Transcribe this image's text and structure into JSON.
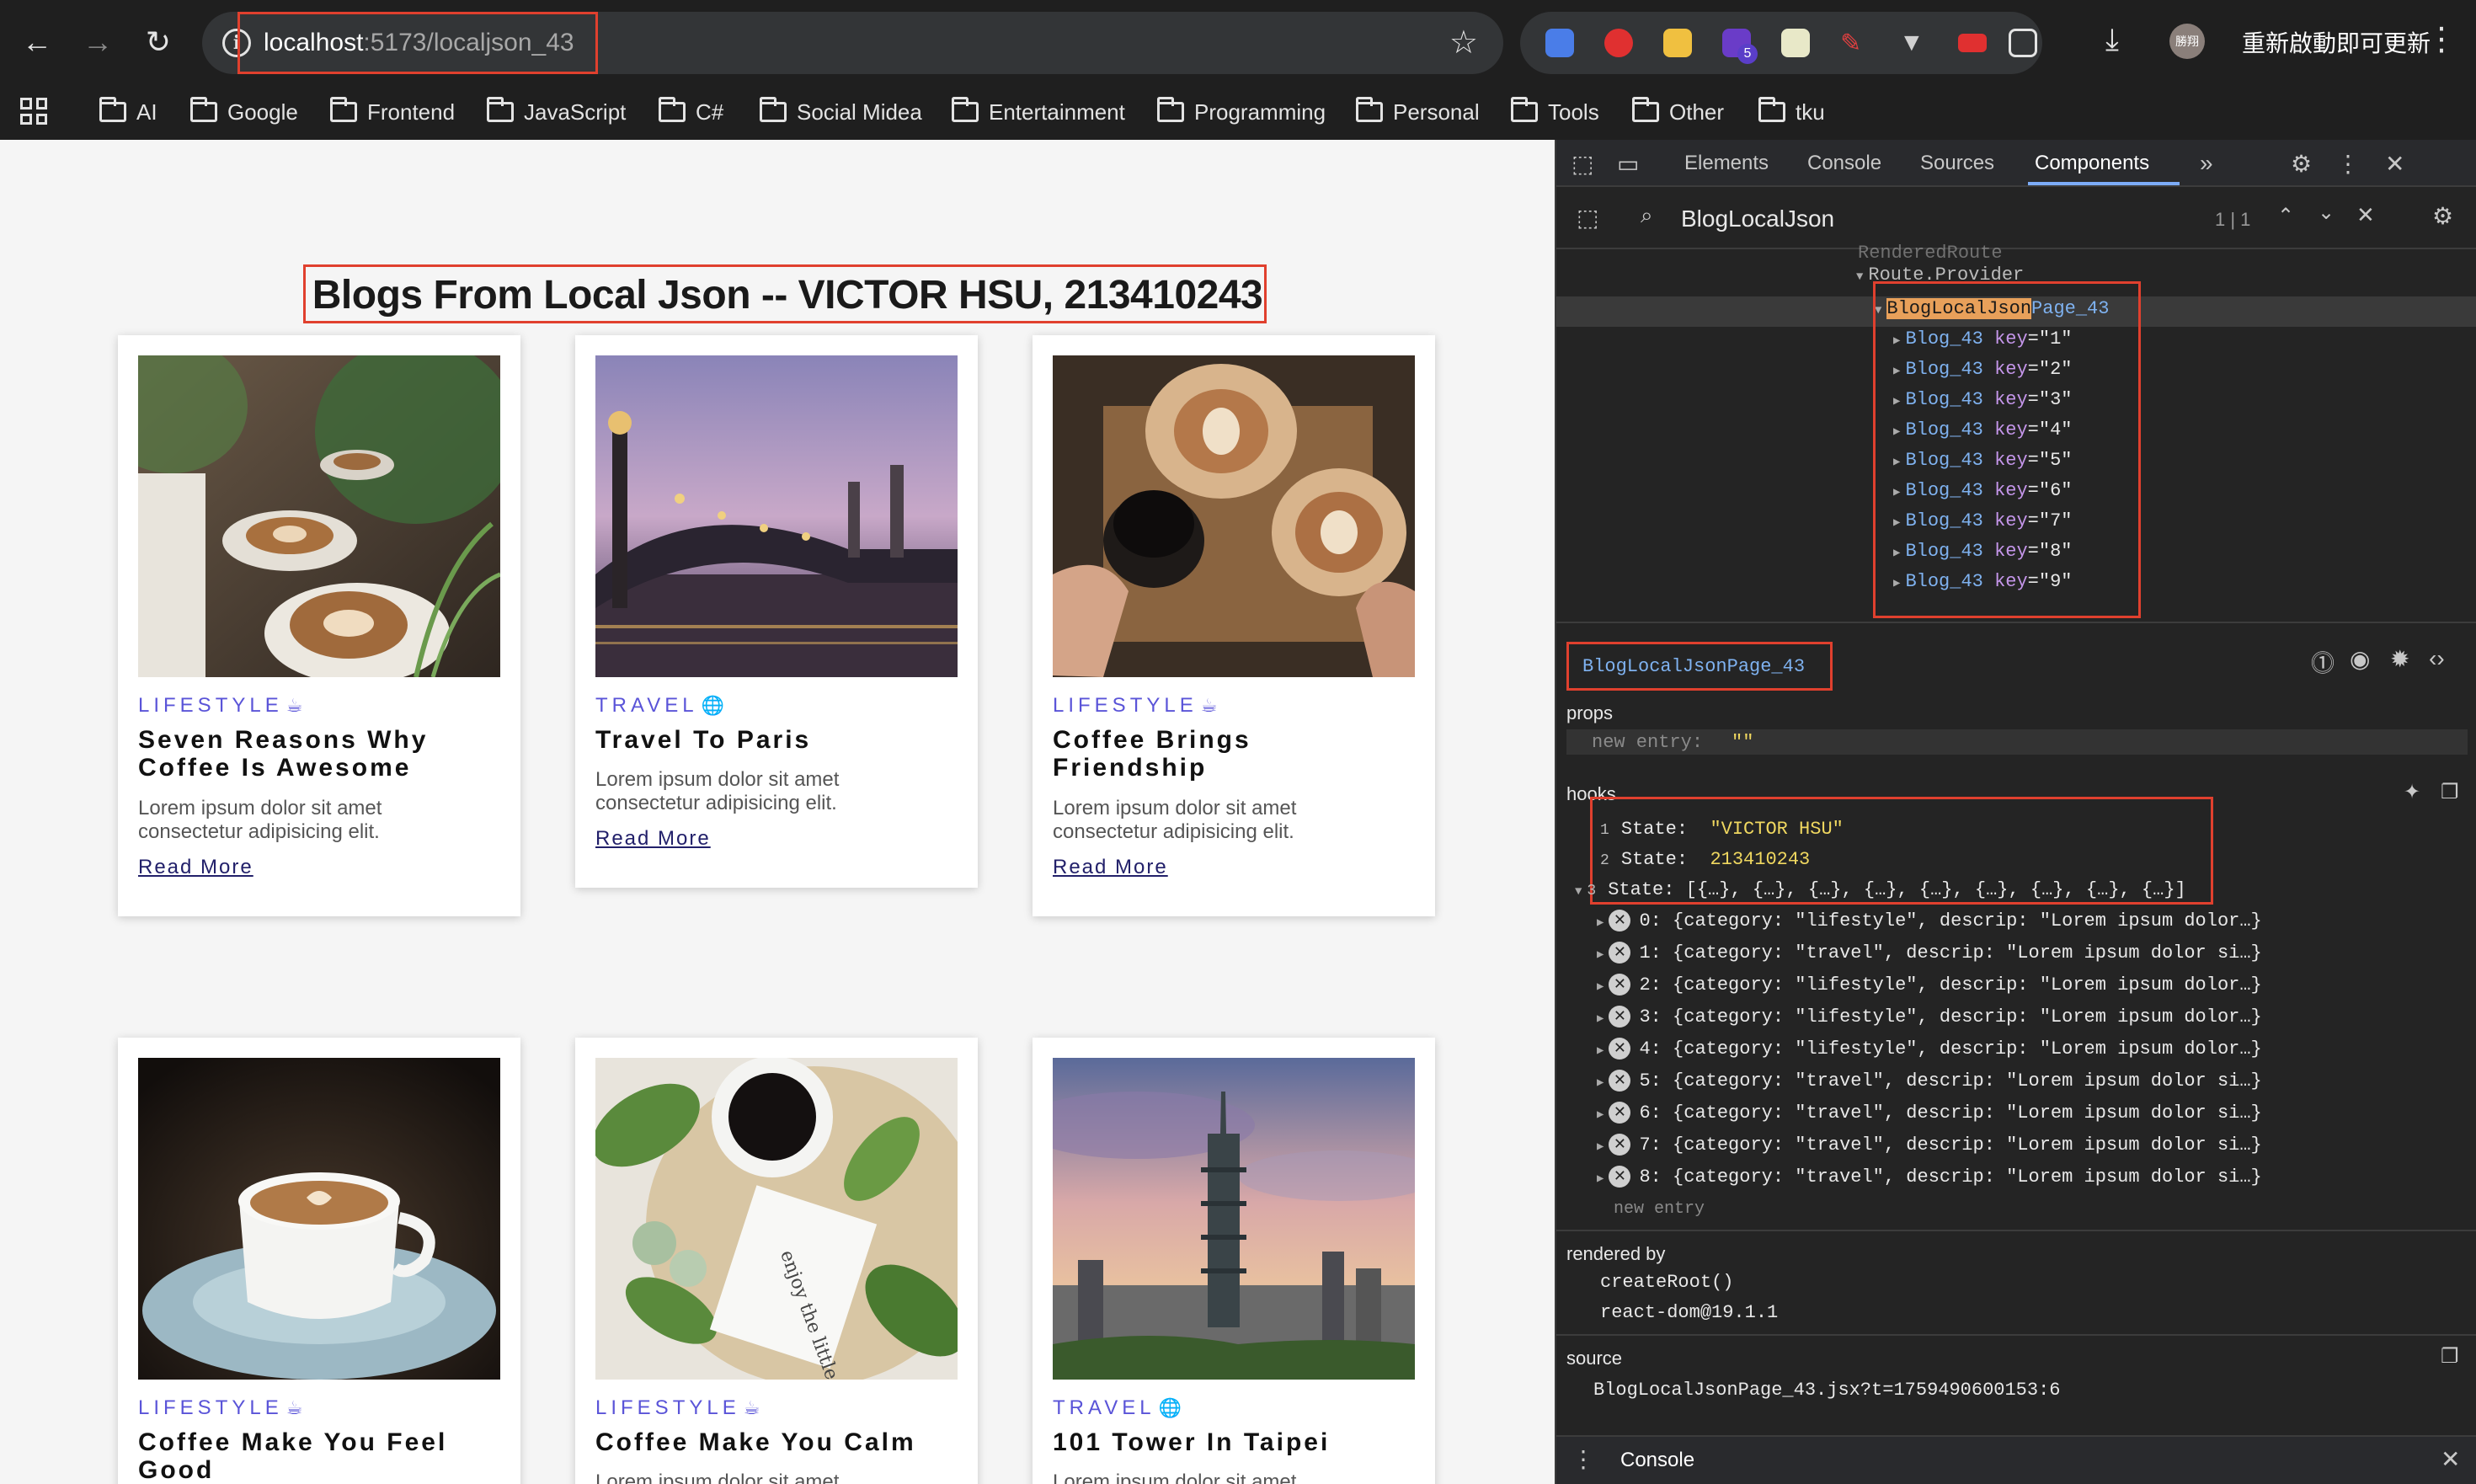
{
  "browser": {
    "url_host": "localhost",
    "url_rest": ":5173/localjson_43",
    "update_label": "重新啟動即可更新",
    "profile_initials": "勝翔",
    "extension_badge": "5",
    "bookmarks": [
      "AI",
      "Google",
      "Frontend",
      "JavaScript",
      "C#",
      "Social Midea",
      "Entertainment",
      "Programming",
      "Personal",
      "Tools",
      "Other",
      "tku"
    ]
  },
  "page": {
    "title": "Blogs From Local Json -- VICTOR HSU, 213410243",
    "read_more": "Read More",
    "cards": [
      {
        "category": "LIFESTYLE",
        "icon": "coffee-icon",
        "title": "Seven Reasons Why Coffee Is Awesome",
        "desc": "Lorem ipsum dolor sit amet consectetur adipisicing elit."
      },
      {
        "category": "TRAVEL",
        "icon": "globe-icon",
        "title": "Travel To Paris",
        "desc": "Lorem ipsum dolor sit amet consectetur adipisicing elit."
      },
      {
        "category": "LIFESTYLE",
        "icon": "coffee-icon",
        "title": "Coffee Brings Friendship",
        "desc": "Lorem ipsum dolor sit amet consectetur adipisicing elit."
      },
      {
        "category": "LIFESTYLE",
        "icon": "coffee-icon",
        "title": "Coffee Make You Feel Good",
        "desc": "Lorem ipsum dolor sit amet consectetur adipisicing elit."
      },
      {
        "category": "LIFESTYLE",
        "icon": "coffee-icon",
        "title": "Coffee Make You Calm",
        "desc": "Lorem ipsum dolor sit amet consectetur adipisicing elit."
      },
      {
        "category": "TRAVEL",
        "icon": "globe-icon",
        "title": "101 Tower In Taipei",
        "desc": "Lorem ipsum dolor sit amet consectetur adipisicing elit."
      }
    ]
  },
  "devtools": {
    "tabs": [
      "Elements",
      "Console",
      "Sources",
      "Components"
    ],
    "active_tab": "Components",
    "search_query": "BlogLocalJson",
    "search_count": "1 | 1",
    "tree": {
      "partial_row": "RenderedRoute",
      "route_provider": "Route.Provider",
      "page_match": "BlogLocalJson",
      "page_suffix": "Page_43",
      "child_name": "Blog_43",
      "child_keys": [
        "\"1\"",
        "\"2\"",
        "\"3\"",
        "\"4\"",
        "\"5\"",
        "\"6\"",
        "\"7\"",
        "\"8\"",
        "\"9\""
      ]
    },
    "selected_component": "BlogLocalJsonPage_43",
    "props_label": "props",
    "props_new_entry": "new entry",
    "props_value": "\"\"",
    "hooks_label": "hooks",
    "hooks": [
      {
        "index": "1",
        "label": "State:",
        "value": "\"VICTOR HSU\""
      },
      {
        "index": "2",
        "label": "State:",
        "value": "213410243"
      },
      {
        "index": "3",
        "label": "State:",
        "value": "[{…}, {…}, {…}, {…}, {…}, {…}, {…}, {…}, {…}]"
      }
    ],
    "state_items": [
      "0: {category: \"lifestyle\", descrip: \"Lorem ipsum dolor…}",
      "1: {category: \"travel\", descrip: \"Lorem ipsum dolor si…}",
      "2: {category: \"lifestyle\", descrip: \"Lorem ipsum dolor…}",
      "3: {category: \"lifestyle\", descrip: \"Lorem ipsum dolor…}",
      "4: {category: \"lifestyle\", descrip: \"Lorem ipsum dolor…}",
      "5: {category: \"travel\", descrip: \"Lorem ipsum dolor si…}",
      "6: {category: \"travel\", descrip: \"Lorem ipsum dolor si…}",
      "7: {category: \"travel\", descrip: \"Lorem ipsum dolor si…}",
      "8: {category: \"travel\", descrip: \"Lorem ipsum dolor si…}"
    ],
    "hooks_new_entry": "new entry",
    "rendered_by_label": "rendered by",
    "rendered_by": [
      "createRoot()",
      "react-dom@19.1.1"
    ],
    "source_label": "source",
    "source": "BlogLocalJsonPage_43.jsx?t=1759490600153:6",
    "console_label": "Console"
  },
  "colors": {
    "accent": "#5a54d8",
    "highlight_box": "#e0402e",
    "component_name": "#7fb2f0"
  }
}
